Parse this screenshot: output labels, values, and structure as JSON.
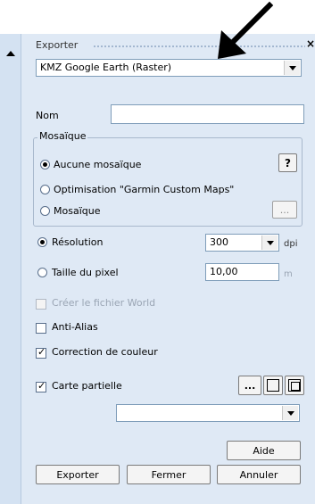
{
  "panel": {
    "title": "Exporter",
    "close_glyph": "×"
  },
  "format_select": {
    "value": "KMZ Google Earth (Raster)"
  },
  "name_field": {
    "label": "Nom",
    "value": ""
  },
  "mosaic_group": {
    "legend": "Mosaïque",
    "options": [
      {
        "label": "Aucune mosaïque",
        "selected": true
      },
      {
        "label": "Optimisation \"Garmin Custom Maps\"",
        "selected": false
      },
      {
        "label": "Mosaïque",
        "selected": false
      }
    ],
    "help_label": "?",
    "browse_label": "..."
  },
  "resolution": {
    "label": "Résolution",
    "selected": true,
    "value": "300",
    "unit": "dpi"
  },
  "pixel_size": {
    "label": "Taille du pixel",
    "selected": false,
    "value": "10,00",
    "unit": "m"
  },
  "checks": {
    "world_file": {
      "label": "Créer le fichier World",
      "checked": false,
      "disabled": true
    },
    "anti_alias": {
      "label": "Anti-Alias",
      "checked": false,
      "disabled": false
    },
    "color_correction": {
      "label": "Correction de couleur",
      "checked": true,
      "disabled": false
    },
    "partial_map": {
      "label": "Carte partielle",
      "checked": true,
      "disabled": false
    }
  },
  "partial_buttons": {
    "browse_label": "..."
  },
  "partial_select": {
    "value": ""
  },
  "buttons": {
    "help": "Aide",
    "export": "Exporter",
    "close": "Fermer",
    "cancel": "Annuler"
  },
  "check_glyph": "✓"
}
